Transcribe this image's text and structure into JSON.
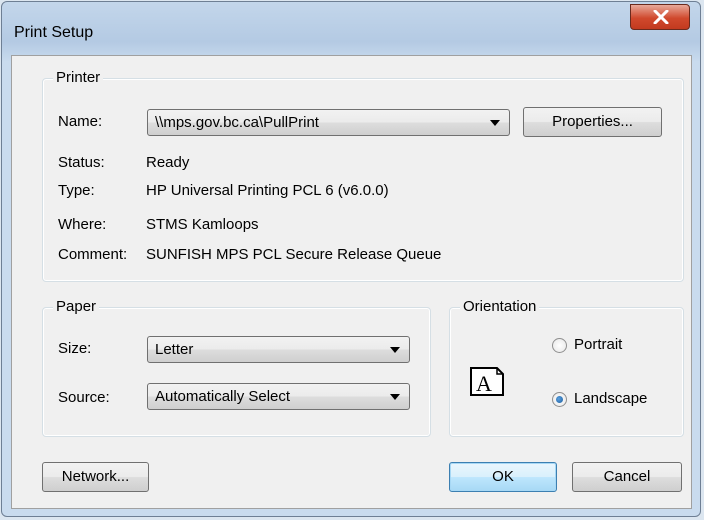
{
  "window": {
    "title": "Print Setup"
  },
  "printer": {
    "legend": "Printer",
    "name_label": "Name:",
    "name_value": "\\\\mps.gov.bc.ca\\PullPrint",
    "properties_button": "Properties...",
    "status_label": "Status:",
    "status_value": "Ready",
    "type_label": "Type:",
    "type_value": "HP Universal Printing PCL 6 (v6.0.0)",
    "where_label": "Where:",
    "where_value": "STMS Kamloops",
    "comment_label": "Comment:",
    "comment_value": "SUNFISH MPS PCL Secure Release Queue"
  },
  "paper": {
    "legend": "Paper",
    "size_label": "Size:",
    "size_value": "Letter",
    "source_label": "Source:",
    "source_value": "Automatically Select"
  },
  "orientation": {
    "legend": "Orientation",
    "icon_letter": "A",
    "portrait_label": "Portrait",
    "landscape_label": "Landscape",
    "selected": "Landscape"
  },
  "buttons": {
    "network": "Network...",
    "ok": "OK",
    "cancel": "Cancel"
  },
  "colors": {
    "close_button": "#c7442a",
    "default_button_border": "#3c7fb1"
  }
}
